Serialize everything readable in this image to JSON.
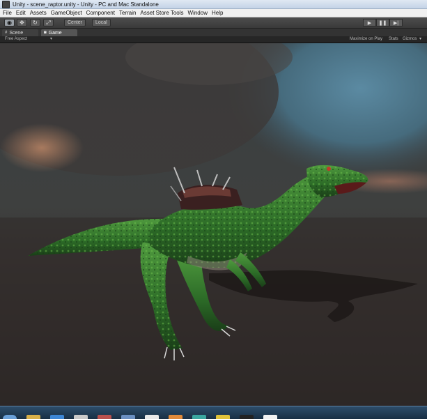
{
  "window": {
    "title": "Unity - scene_raptor.unity - Unity - PC and Mac Standalone"
  },
  "menu": [
    "File",
    "Edit",
    "Assets",
    "GameObject",
    "Component",
    "Terrain",
    "Asset Store Tools",
    "Window",
    "Help"
  ],
  "toolbar": {
    "tools": [
      {
        "name": "hand-tool",
        "icon": "eye",
        "glyph": "◉",
        "active": true
      },
      {
        "name": "move-tool",
        "icon": "move",
        "glyph": "✥",
        "active": false
      },
      {
        "name": "rotate-tool",
        "icon": "rotate",
        "glyph": "↻",
        "active": false
      },
      {
        "name": "scale-tool",
        "icon": "scale",
        "glyph": "⤢",
        "active": false
      }
    ],
    "pivot_label": "Center",
    "space_label": "Local",
    "play_glyph": "▶",
    "pause_glyph": "❚❚",
    "step_glyph": "▶|"
  },
  "tabs": [
    {
      "label": "Scene",
      "icon": "scene-icon",
      "glyph": "#",
      "active": false
    },
    {
      "label": "Game",
      "icon": "game-icon",
      "glyph": "◙",
      "active": true
    }
  ],
  "game_view": {
    "aspect": "Free Aspect",
    "aspect_arrow": "▾",
    "maximize_label": "Maximize on Play",
    "stats_label": "Stats",
    "gizmos_label": "Gizmos",
    "gizmos_arrow": "▾"
  },
  "colors": {
    "sky_top": "#343a3e",
    "sky_blue": "#4c6f84",
    "ground": "#2d2827",
    "raptor_green": "#2f6b2a",
    "cloud_glow": "#b07a5c"
  },
  "taskbar": {
    "icons": [
      "start-orb",
      "explorer",
      "browser",
      "chrome",
      "app-red",
      "app-blue",
      "app-white",
      "app-orange",
      "app-teal",
      "app-yellow",
      "app-black",
      "app-white-2"
    ]
  }
}
